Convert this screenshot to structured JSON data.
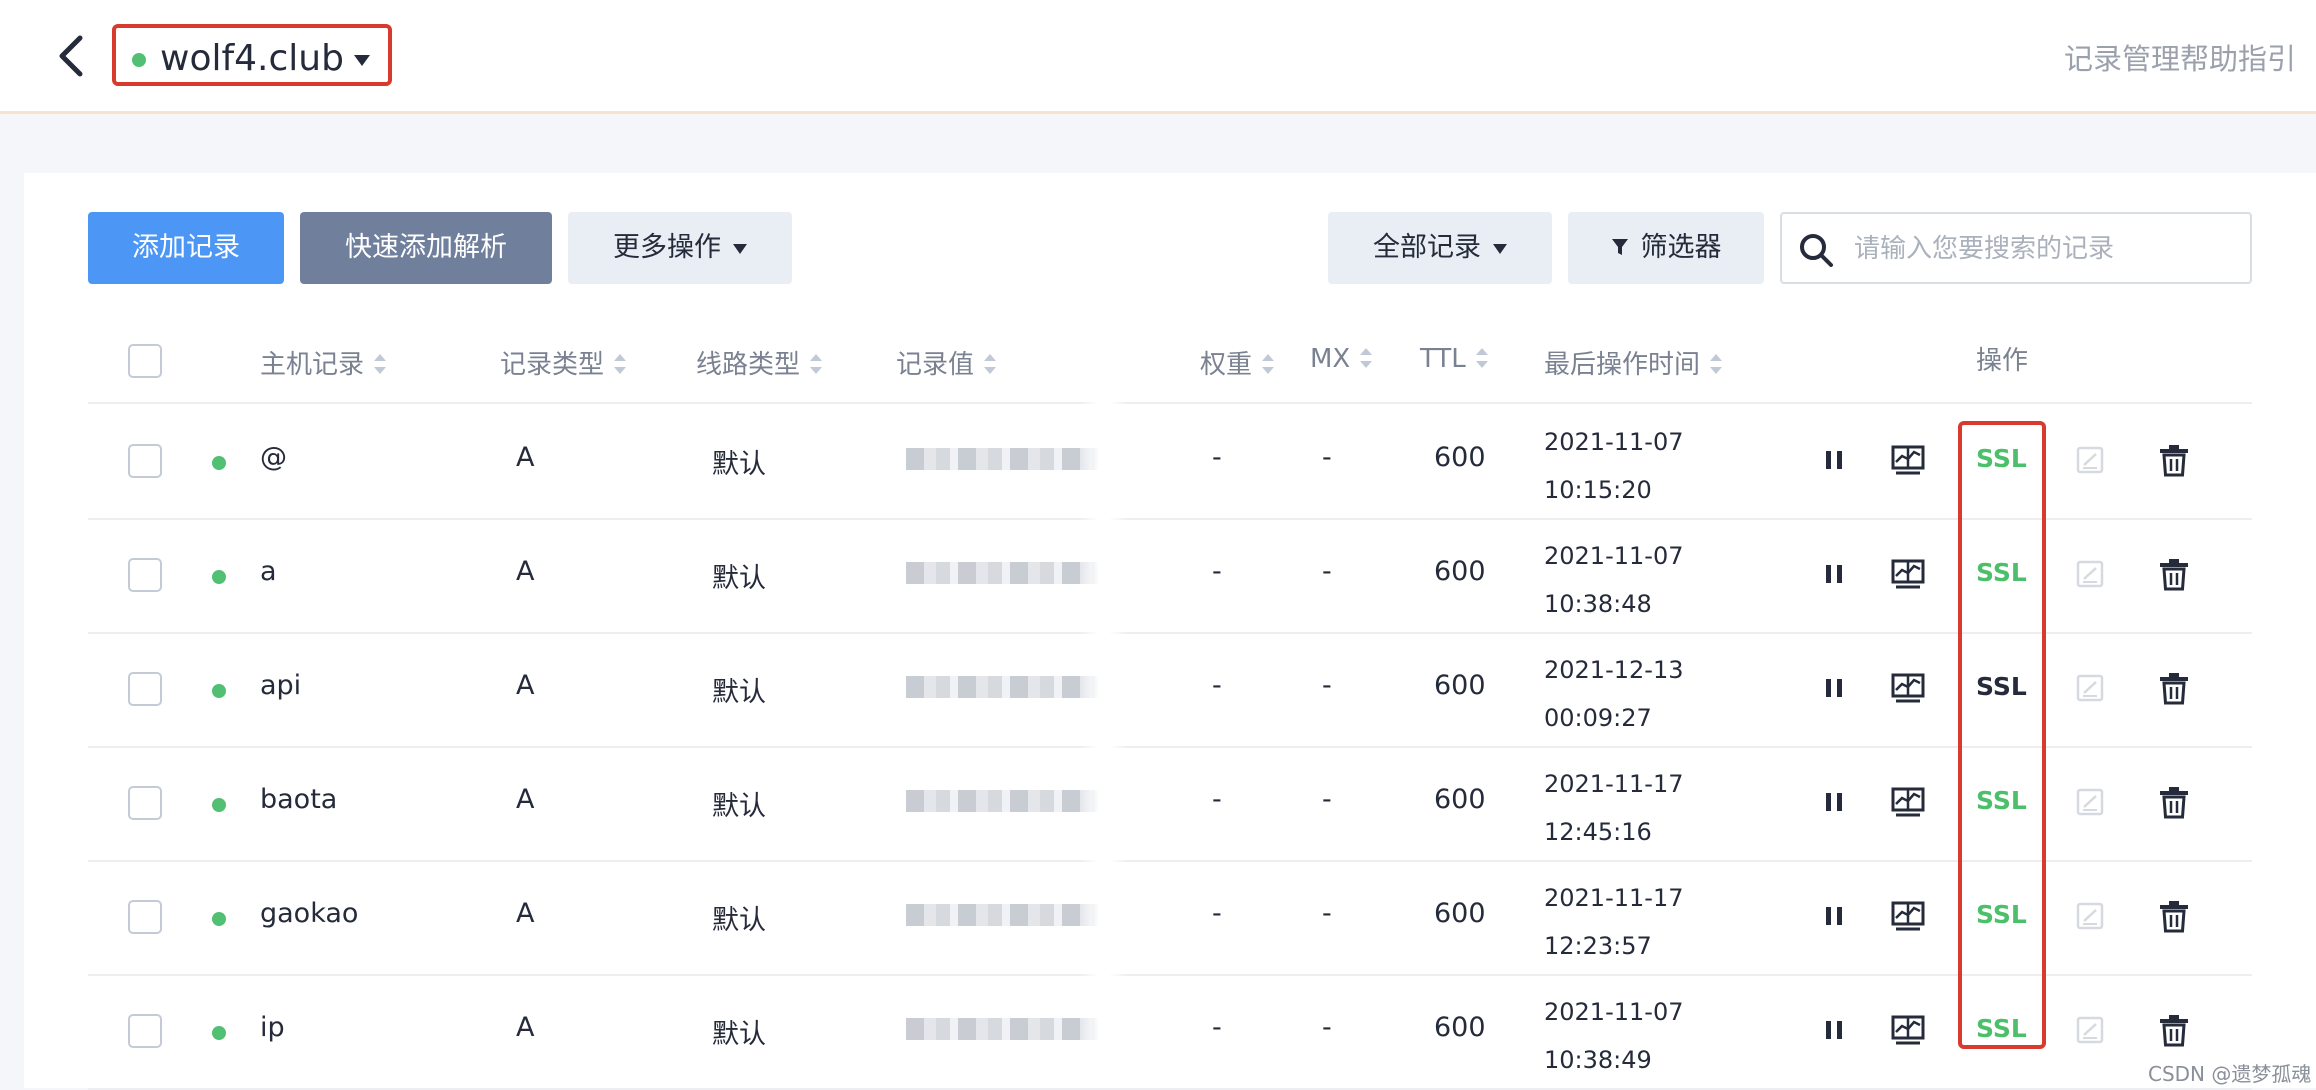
{
  "header": {
    "domain": "wolf4.club",
    "help_link": "记录管理帮助指引"
  },
  "toolbar": {
    "add_record": "添加记录",
    "quick_add": "快速添加解析",
    "more_actions": "更多操作",
    "all_records": "全部记录",
    "filter": "筛选器",
    "search_placeholder": "请输入您要搜索的记录",
    "search_value": ""
  },
  "table": {
    "columns": [
      "主机记录",
      "记录类型",
      "线路类型",
      "记录值",
      "权重",
      "MX",
      "TTL",
      "最后操作时间",
      "操作"
    ],
    "rows": [
      {
        "host": "@",
        "type": "A",
        "line": "默认",
        "value": "",
        "weight": "-",
        "mx": "-",
        "ttl": "600",
        "date": "2021-11-07",
        "time": "10:15:20",
        "ssl": "SSL",
        "ssl_color": "#4cbf6a"
      },
      {
        "host": "a",
        "type": "A",
        "line": "默认",
        "value": "",
        "weight": "-",
        "mx": "-",
        "ttl": "600",
        "date": "2021-11-07",
        "time": "10:38:48",
        "ssl": "SSL",
        "ssl_color": "#4cbf6a"
      },
      {
        "host": "api",
        "type": "A",
        "line": "默认",
        "value": "",
        "weight": "-",
        "mx": "-",
        "ttl": "600",
        "date": "2021-12-13",
        "time": "00:09:27",
        "ssl": "SSL",
        "ssl_color": "#252b3a"
      },
      {
        "host": "baota",
        "type": "A",
        "line": "默认",
        "value": "",
        "weight": "-",
        "mx": "-",
        "ttl": "600",
        "date": "2021-11-17",
        "time": "12:45:16",
        "ssl": "SSL",
        "ssl_color": "#4cbf6a"
      },
      {
        "host": "gaokao",
        "type": "A",
        "line": "默认",
        "value": "",
        "weight": "-",
        "mx": "-",
        "ttl": "600",
        "date": "2021-11-17",
        "time": "12:23:57",
        "ssl": "SSL",
        "ssl_color": "#4cbf6a"
      },
      {
        "host": "ip",
        "type": "A",
        "line": "默认",
        "value": "",
        "weight": "-",
        "mx": "-",
        "ttl": "600",
        "date": "2021-11-07",
        "time": "10:38:49",
        "ssl": "SSL",
        "ssl_color": "#4cbf6a"
      }
    ]
  },
  "icons": {
    "back": "chevron-left-icon",
    "pause": "pause-icon",
    "monitor": "monitor-icon",
    "edit": "edit-icon",
    "delete": "trash-icon"
  },
  "colors": {
    "primary": "#4c96f5",
    "status_green": "#52c073",
    "ssl_green": "#4cbf6a",
    "highlight_red": "#d93a2e"
  },
  "watermark": "CSDN @遗梦孤魂"
}
